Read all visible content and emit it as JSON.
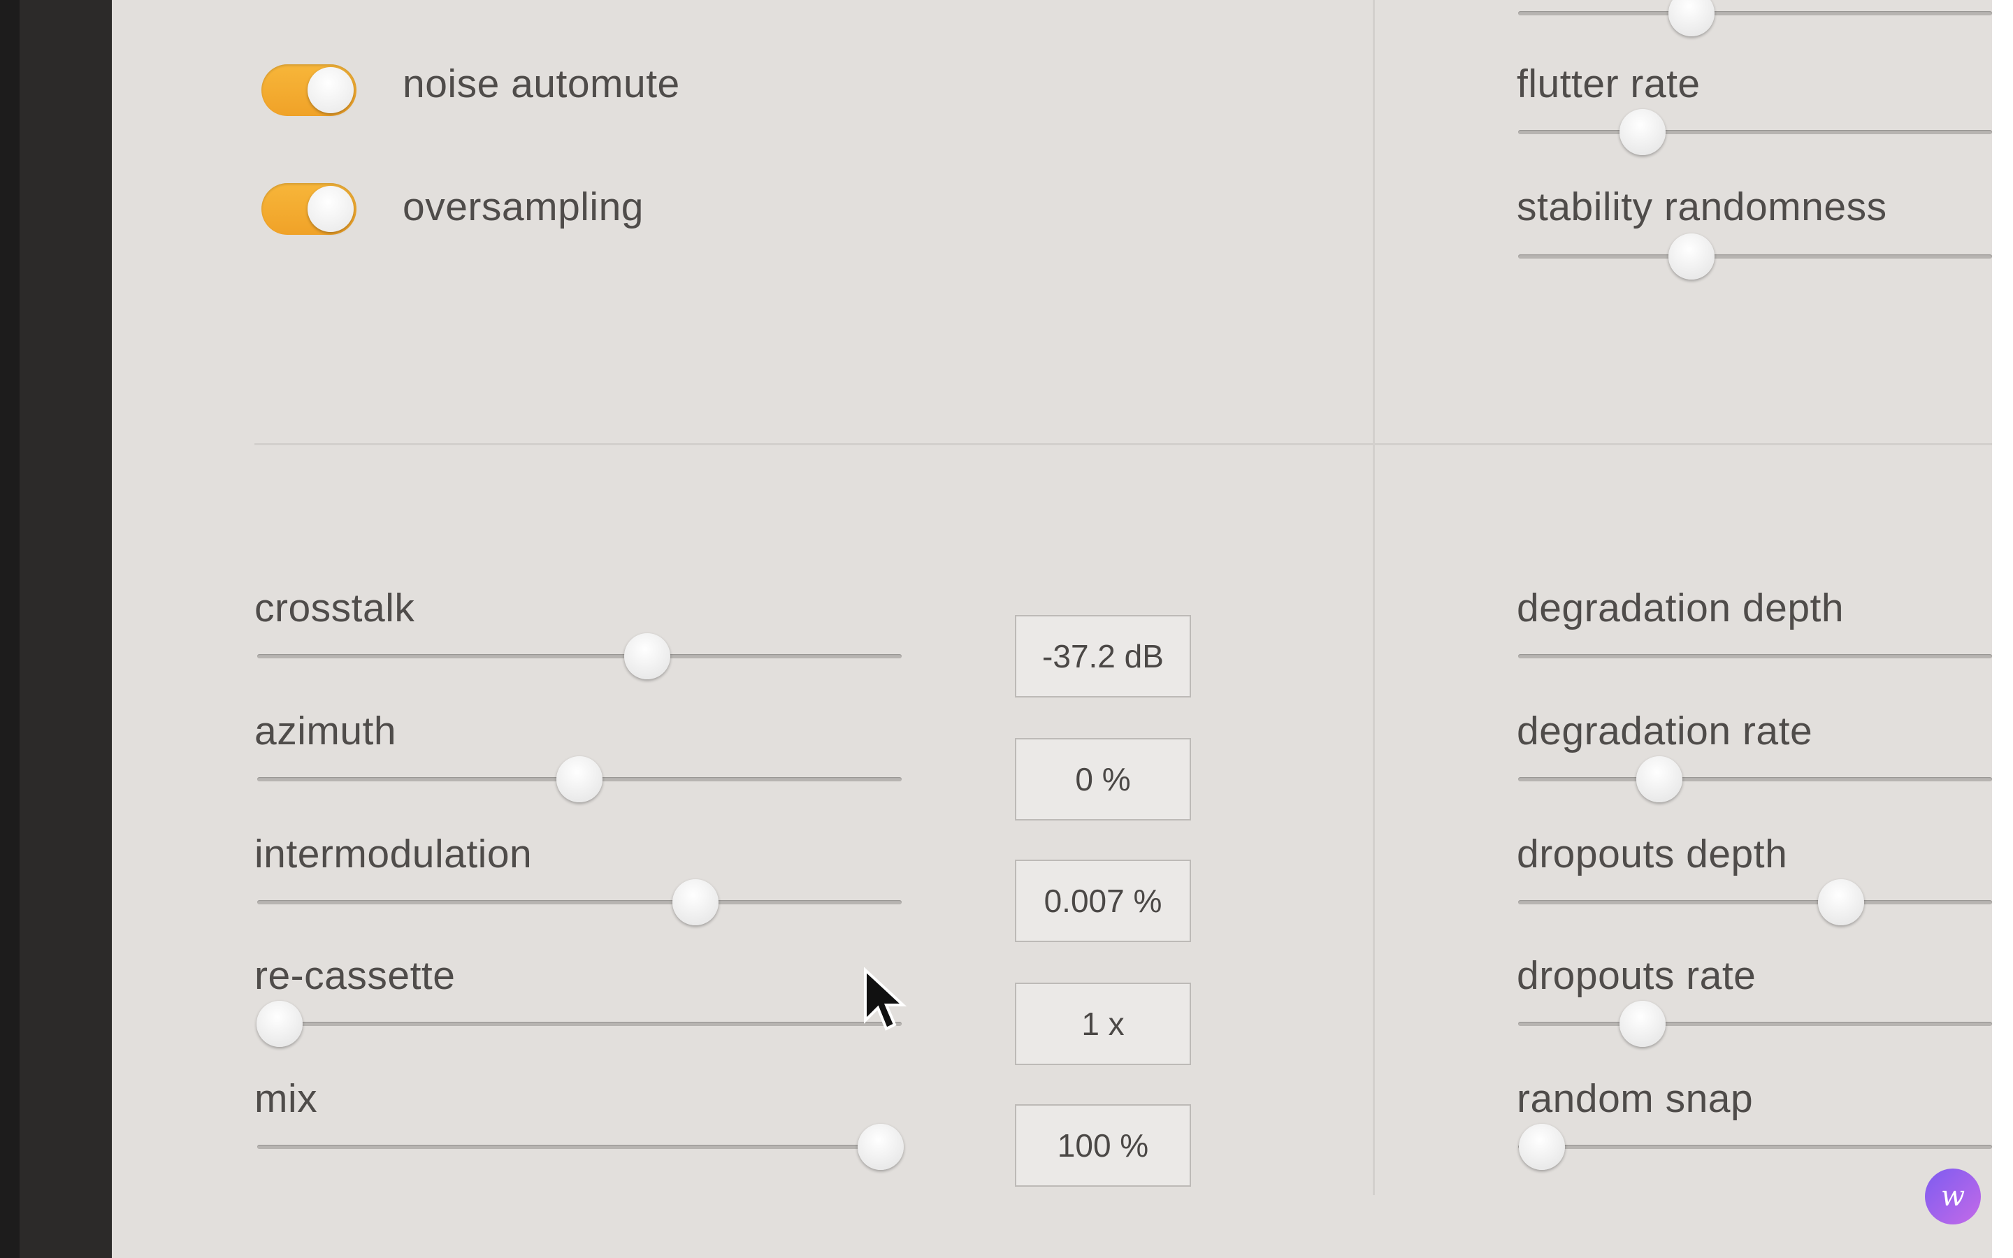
{
  "toggles": [
    {
      "label": "noise automute",
      "on": true
    },
    {
      "label": "oversampling",
      "on": true
    }
  ],
  "left_controls": [
    {
      "label": "crosstalk",
      "value_text": "-37.2 dB",
      "position": 0.6
    },
    {
      "label": "azimuth",
      "value_text": "0 %",
      "position": 0.5
    },
    {
      "label": "intermodulation",
      "value_text": "0.007 %",
      "position": 0.68
    },
    {
      "label": "re-cassette",
      "value_text": "1 x",
      "position": 0.0
    },
    {
      "label": "mix",
      "value_text": "100 %",
      "position": 1.0
    }
  ],
  "right_top_controls": [
    {
      "label": "flutter rate"
    },
    {
      "label": "stability randomness"
    }
  ],
  "right_bottom_controls": [
    {
      "label": "degradation depth"
    },
    {
      "label": "degradation rate"
    },
    {
      "label": "dropouts depth"
    },
    {
      "label": "dropouts rate"
    },
    {
      "label": "random snap"
    }
  ],
  "colors": {
    "panel_bg": "#e2dfdc",
    "toggle_on": "#f4ac30",
    "text": "#4f4c4a",
    "value_box_bg": "#ebe9e7"
  },
  "icons": {
    "cursor": "mouse-pointer-icon",
    "corner_badge": "app-logo-icon"
  }
}
